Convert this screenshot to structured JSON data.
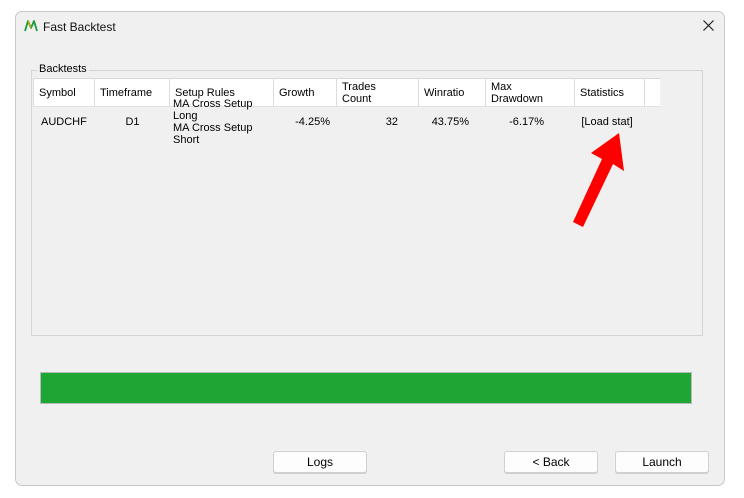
{
  "window": {
    "title": "Fast Backtest",
    "close_glyph": "✕"
  },
  "backtests": {
    "group_label": "Backtests",
    "columns": [
      {
        "key": "symbol",
        "label": "Symbol"
      },
      {
        "key": "timeframe",
        "label": "Timeframe"
      },
      {
        "key": "setup_rules",
        "label": "Setup Rules"
      },
      {
        "key": "growth",
        "label": "Growth"
      },
      {
        "key": "trades_count",
        "label": "Trades Count"
      },
      {
        "key": "winratio",
        "label": "Winratio"
      },
      {
        "key": "max_drawdown",
        "label": "Max Drawdown"
      },
      {
        "key": "statistics",
        "label": "Statistics"
      }
    ],
    "rows": [
      {
        "symbol": "AUDCHF",
        "timeframe": "D1",
        "setup_rules": [
          "MA Cross Setup Long",
          "MA Cross Setup Short"
        ],
        "growth": "-4.25%",
        "trades_count": "32",
        "winratio": "43.75%",
        "max_drawdown": "-6.17%",
        "statistics": "[Load stat]"
      }
    ]
  },
  "progress": {
    "fraction": 1.0,
    "color": "#1ea635"
  },
  "buttons": {
    "logs": "Logs",
    "back": "< Back",
    "launch": "Launch"
  },
  "annotation": {
    "arrow_color": "#ff0000"
  }
}
